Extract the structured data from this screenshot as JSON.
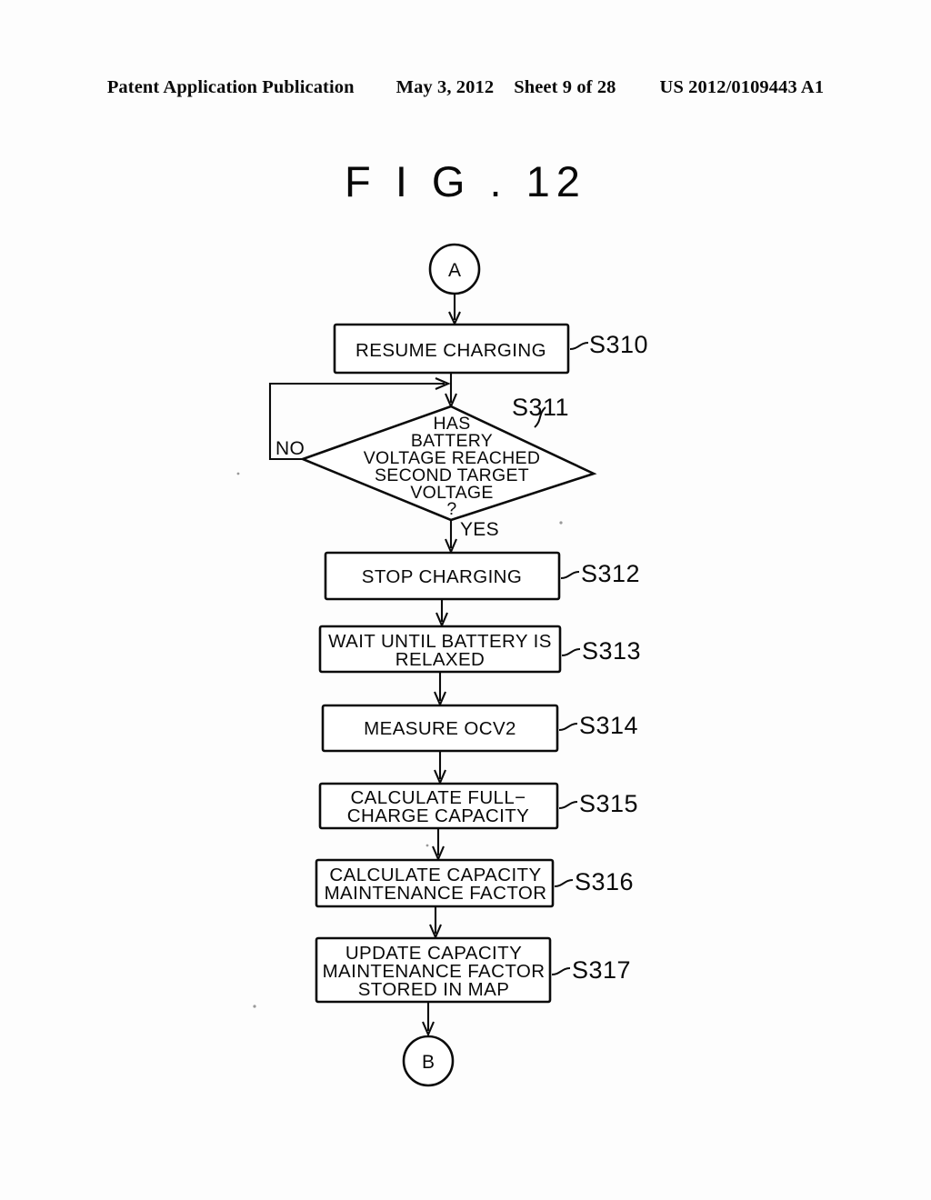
{
  "header": {
    "publication": "Patent Application Publication",
    "date": "May 3, 2012",
    "sheet": "Sheet 9 of 28",
    "docnum": "US 2012/0109443 A1"
  },
  "figure": {
    "title": "F I G . 12"
  },
  "connectors": {
    "start": "A",
    "end": "B"
  },
  "edge_labels": {
    "no": "NO",
    "yes": "YES"
  },
  "nodes": [
    {
      "id": "S310",
      "type": "process",
      "label": "S310",
      "lines": [
        "RESUME CHARGING"
      ]
    },
    {
      "id": "S311",
      "type": "decision",
      "label": "S311",
      "lines": [
        "HAS",
        "BATTERY",
        "VOLTAGE REACHED",
        "SECOND TARGET",
        "VOLTAGE",
        "?"
      ]
    },
    {
      "id": "S312",
      "type": "process",
      "label": "S312",
      "lines": [
        "STOP CHARGING"
      ]
    },
    {
      "id": "S313",
      "type": "process",
      "label": "S313",
      "lines": [
        "WAIT UNTIL BATTERY IS",
        "RELAXED"
      ]
    },
    {
      "id": "S314",
      "type": "process",
      "label": "S314",
      "lines": [
        "MEASURE OCV2"
      ]
    },
    {
      "id": "S315",
      "type": "process",
      "label": "S315",
      "lines": [
        "CALCULATE FULL−",
        "CHARGE CAPACITY"
      ]
    },
    {
      "id": "S316",
      "type": "process",
      "label": "S316",
      "lines": [
        "CALCULATE CAPACITY",
        "MAINTENANCE FACTOR"
      ]
    },
    {
      "id": "S317",
      "type": "process",
      "label": "S317",
      "lines": [
        "UPDATE CAPACITY",
        "MAINTENANCE FACTOR",
        "STORED IN MAP"
      ]
    }
  ],
  "colors": {
    "ink": "#0b0b0b",
    "paper": "#fdfdfd"
  }
}
